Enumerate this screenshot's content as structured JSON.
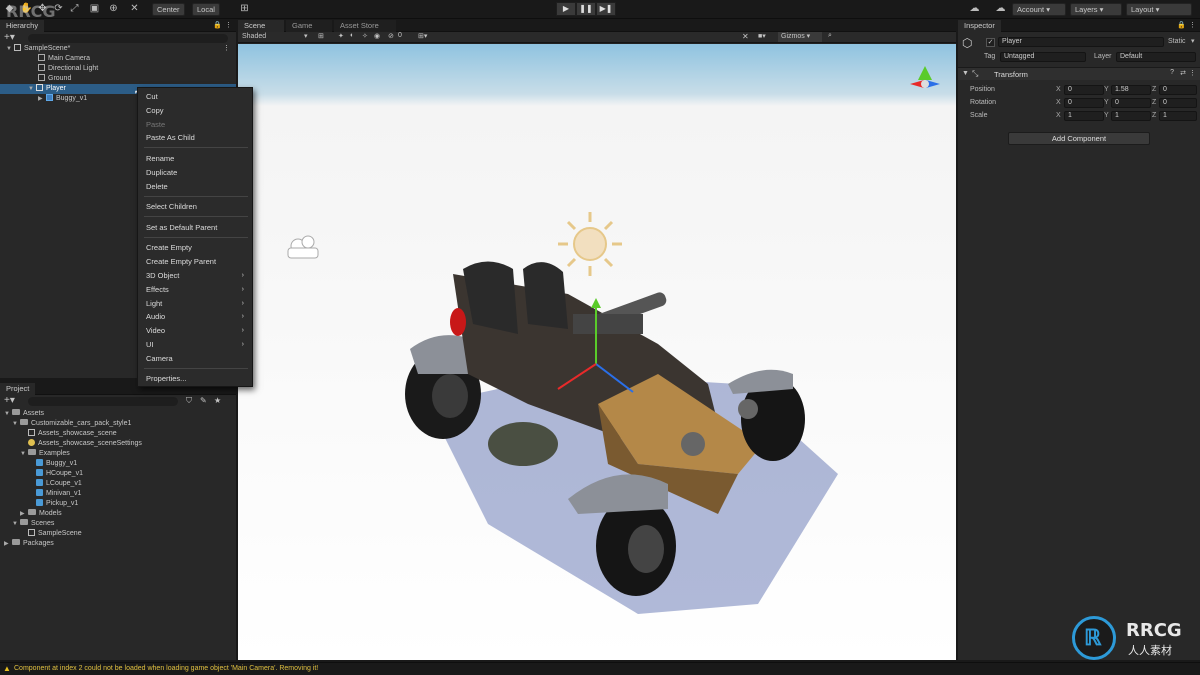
{
  "toolbar": {
    "account_label": "Account",
    "layers_label": "Layers",
    "layout_label": "Layout",
    "center_label": "Center",
    "local_label": "Local",
    "watermark_label": "RRCG"
  },
  "hierarchy": {
    "tab_label": "Hierarchy",
    "scene_name": "SampleScene*",
    "items": [
      {
        "label": "Main Camera"
      },
      {
        "label": "Directional Light"
      },
      {
        "label": "Ground"
      },
      {
        "label": "Player"
      },
      {
        "label": "Buggy_v1"
      }
    ]
  },
  "context_menu": {
    "items": [
      {
        "label": "Cut"
      },
      {
        "label": "Copy"
      },
      {
        "label": "Paste"
      },
      {
        "label": "Paste As Child"
      },
      {
        "label": "Rename"
      },
      {
        "label": "Duplicate"
      },
      {
        "label": "Delete"
      },
      {
        "label": "Select Children"
      },
      {
        "label": "Set as Default Parent"
      },
      {
        "label": "Create Empty"
      },
      {
        "label": "Create Empty Parent"
      },
      {
        "label": "3D Object"
      },
      {
        "label": "Effects"
      },
      {
        "label": "Light"
      },
      {
        "label": "Audio"
      },
      {
        "label": "Video"
      },
      {
        "label": "UI"
      },
      {
        "label": "Camera"
      },
      {
        "label": "Properties..."
      }
    ]
  },
  "project": {
    "tab_label": "Project",
    "items": [
      {
        "label": "Assets"
      },
      {
        "label": "Customizable_cars_pack_style1"
      },
      {
        "label": "Assets_showcase_scene"
      },
      {
        "label": "Assets_showcase_sceneSettings"
      },
      {
        "label": "Examples"
      },
      {
        "label": "Buggy_v1"
      },
      {
        "label": "HCoupe_v1"
      },
      {
        "label": "LCoupe_v1"
      },
      {
        "label": "Minivan_v1"
      },
      {
        "label": "Pickup_v1"
      },
      {
        "label": "Models"
      },
      {
        "label": "Scenes"
      },
      {
        "label": "SampleScene"
      },
      {
        "label": "Packages"
      }
    ]
  },
  "scene_view": {
    "tabs": [
      {
        "label": "Scene"
      },
      {
        "label": "Game"
      },
      {
        "label": "Asset Store"
      }
    ],
    "shading_mode": "Shaded",
    "gizmos_label": "Gizmos",
    "gizmo_count": "0"
  },
  "inspector": {
    "tab_label": "Inspector",
    "object_name": "Player",
    "static_label": "Static",
    "tag_label": "Tag",
    "tag_value": "Untagged",
    "layer_label": "Layer",
    "layer_value": "Default",
    "component_label": "Transform",
    "rows": [
      {
        "label": "Position",
        "x": "0",
        "y": "1.58",
        "z": "0"
      },
      {
        "label": "Rotation",
        "x": "0",
        "y": "0",
        "z": "0"
      },
      {
        "label": "Scale",
        "x": "1",
        "y": "1",
        "z": "1"
      }
    ],
    "add_component_label": "Add Component"
  },
  "status_bar": {
    "message": "Component at index 2 could not be loaded when loading game object 'Main Camera'. Removing it!"
  },
  "logo": {
    "brand": "RRCG",
    "subtitle": "人人素材"
  },
  "colors": {
    "selection": "#2c5d87",
    "warning": "#e8c020",
    "sky_top": "#8fc3e0"
  }
}
